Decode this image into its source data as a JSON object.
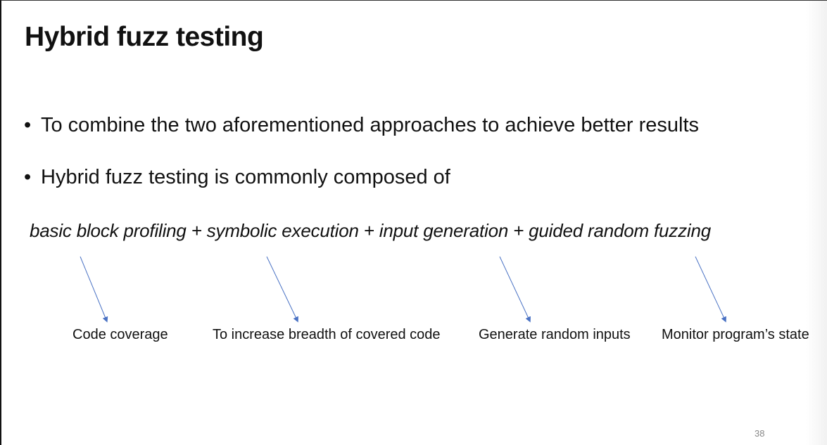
{
  "slide": {
    "title": "Hybrid fuzz testing",
    "bullets": [
      "To combine the two aforementioned approaches to achieve better results",
      "Hybrid fuzz testing is commonly composed of"
    ],
    "formula": "basic block profiling + symbolic execution + input generation + guided random fuzzing",
    "annotations": [
      "Code coverage",
      "To increase breadth of covered code",
      "Generate random inputs",
      "Monitor program’s state"
    ],
    "page_number": "38",
    "bullet_glyph": "•",
    "arrow_color": "#4a72c4"
  }
}
